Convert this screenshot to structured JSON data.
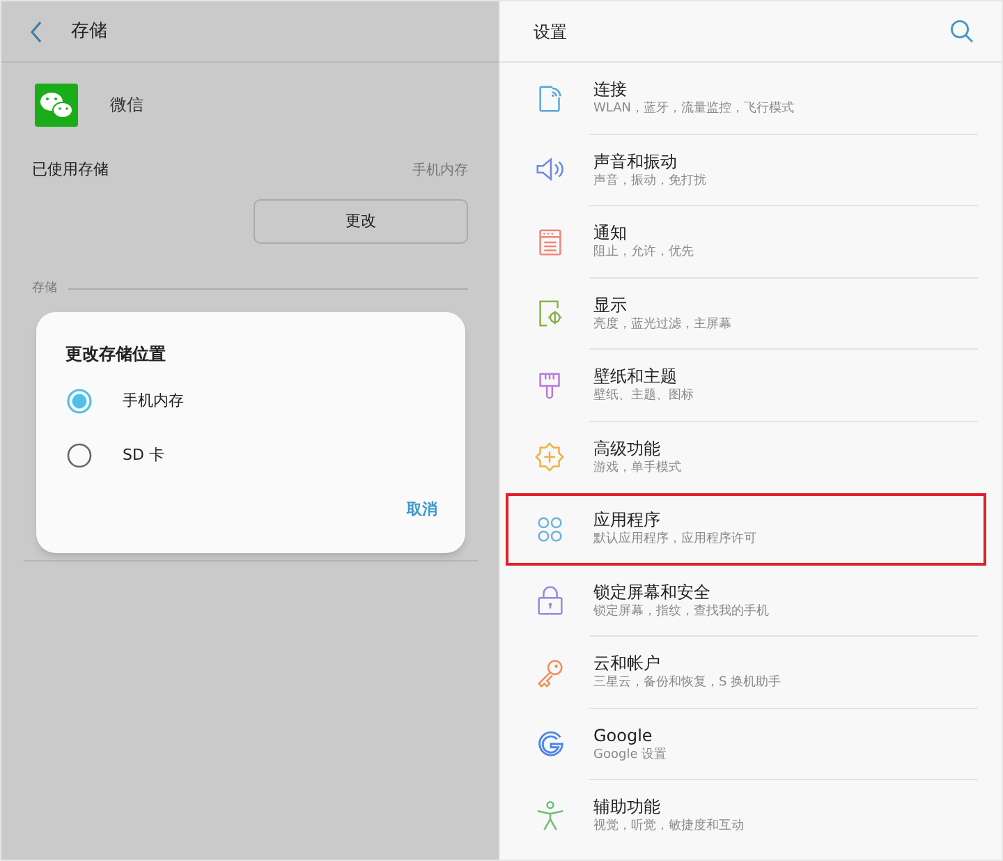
{
  "storage_screen": {
    "title": "存储",
    "app_name": "微信",
    "used_storage": {
      "label": "已使用存储",
      "value": "手机内存"
    },
    "change_button": "更改",
    "section_label": "存储"
  },
  "dialog": {
    "title": "更改存储位置",
    "options": [
      {
        "label": "手机内存",
        "selected": true
      },
      {
        "label": "SD 卡",
        "selected": false
      }
    ],
    "cancel": "取消"
  },
  "settings": {
    "title": "设置",
    "items": [
      {
        "title": "连接",
        "subtitle": "WLAN，蓝牙，流量监控，飞行模式",
        "highlighted": false
      },
      {
        "title": "声音和振动",
        "subtitle": "声音，振动，免打扰",
        "highlighted": false
      },
      {
        "title": "通知",
        "subtitle": "阻止，允许，优先",
        "highlighted": false
      },
      {
        "title": "显示",
        "subtitle": "亮度，蓝光过滤，主屏幕",
        "highlighted": false
      },
      {
        "title": "壁纸和主题",
        "subtitle": "壁纸、主题、图标",
        "highlighted": false
      },
      {
        "title": "高级功能",
        "subtitle": "游戏，单手模式",
        "highlighted": false
      },
      {
        "title": "应用程序",
        "subtitle": "默认应用程序，应用程序许可",
        "highlighted": true
      },
      {
        "title": "锁定屏幕和安全",
        "subtitle": "锁定屏幕，指纹，查找我的手机",
        "highlighted": false
      },
      {
        "title": "云和帐户",
        "subtitle": "三星云，备份和恢复，S 换机助手",
        "highlighted": false
      },
      {
        "title": "Google",
        "subtitle": "Google 设置",
        "highlighted": false
      },
      {
        "title": "辅助功能",
        "subtitle": "视觉，听觉，敏捷度和互动",
        "highlighted": false
      }
    ]
  }
}
